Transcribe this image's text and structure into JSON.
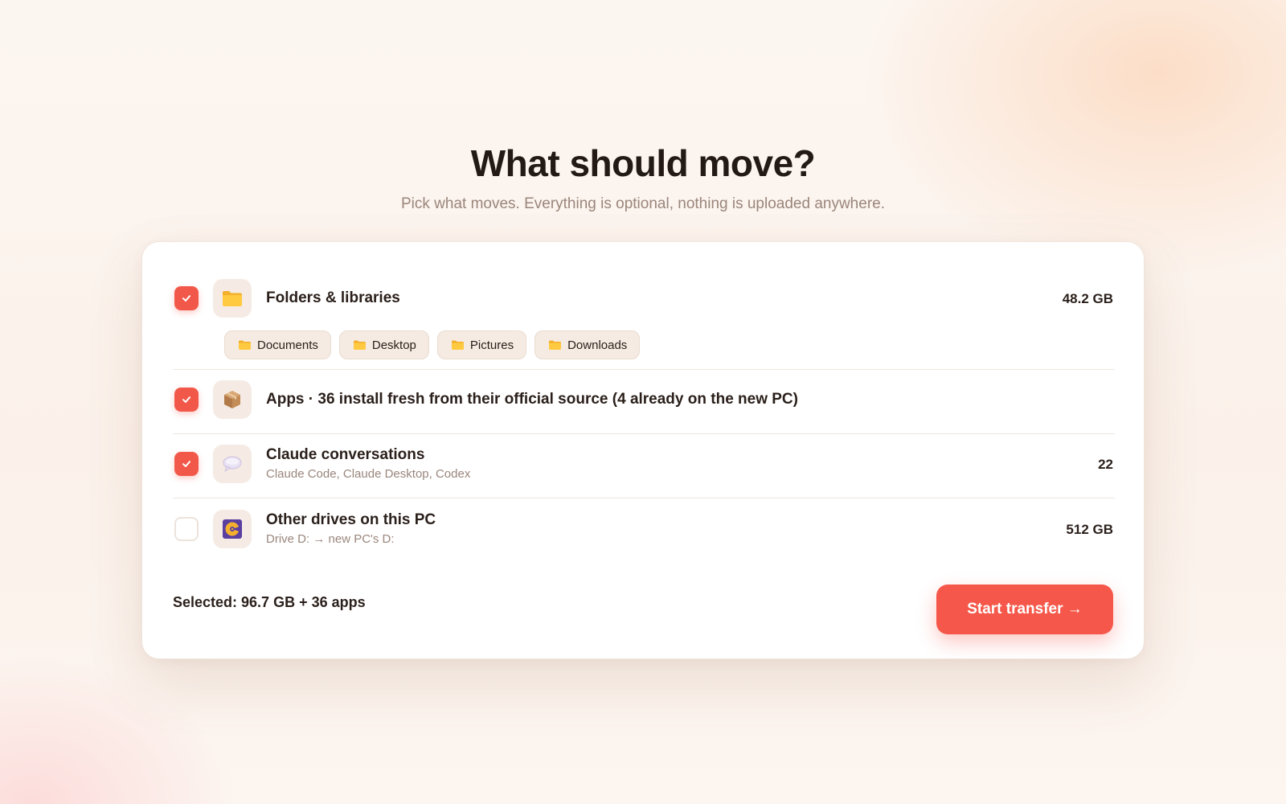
{
  "header": {
    "title": "What should move?",
    "subtitle": "Pick what moves. Everything is optional, nothing is uploaded anywhere."
  },
  "items": [
    {
      "icon": "folder-icon",
      "title": "Folders & libraries",
      "value": "48.2 GB",
      "checked": true,
      "folders": [
        "Documents",
        "Desktop",
        "Pictures",
        "Downloads"
      ]
    },
    {
      "icon": "package-icon",
      "title": "Apps · 36 install fresh from their official source (4 already on the new PC)",
      "checked": true
    },
    {
      "icon": "speech-bubble-icon",
      "title": "Claude conversations",
      "subtitle": "Claude Code, Claude Desktop, Codex",
      "value": "22",
      "checked": true
    },
    {
      "icon": "drive-icon",
      "title": "Other drives on this PC",
      "subtitle": "Drive D: → new PC's D:",
      "value": "512 GB",
      "checked": false
    }
  ],
  "footer": {
    "selected_summary": "Selected: 96.7 GB + 36 apps",
    "start_label": "Start transfer →"
  },
  "colors": {
    "accent": "#f5584a",
    "muted_text": "#9a867c",
    "chip_bg": "#f5ebe3"
  }
}
